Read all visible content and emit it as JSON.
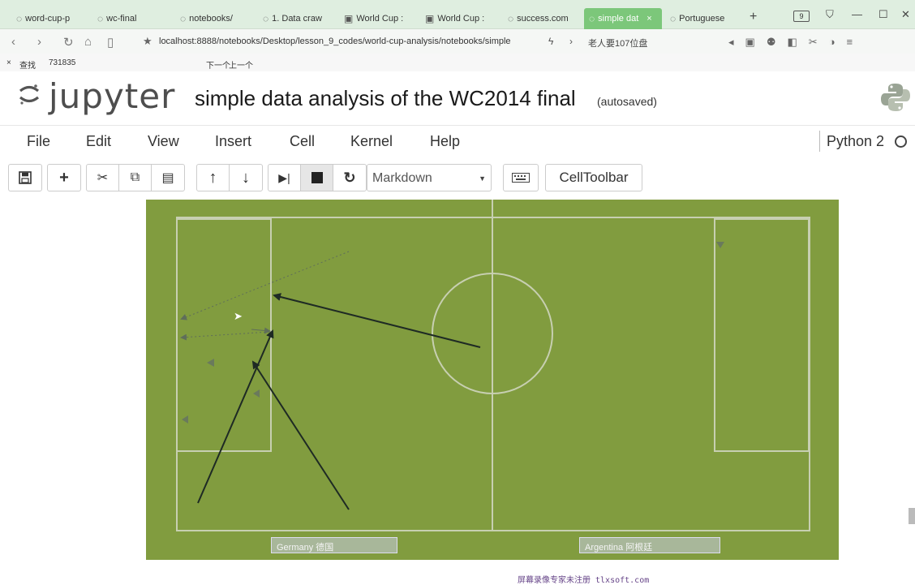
{
  "browser": {
    "tabs": [
      {
        "label": "word-cup-p"
      },
      {
        "label": "wc-final"
      },
      {
        "label": "notebooks/"
      },
      {
        "label": "1. Data craw"
      },
      {
        "label": "World Cup :"
      },
      {
        "label": "World Cup :"
      },
      {
        "label": "success.com"
      },
      {
        "label": "simple dat",
        "active": true
      },
      {
        "label": "Portuguese"
      }
    ],
    "tab_count": "9",
    "url": "localhost:8888/notebooks/Desktop/lesson_9_codes/world-cup-analysis/notebooks/simple",
    "search_hint": "老人要107位盘",
    "find": {
      "label": "查找",
      "value": "731835",
      "next": "下一个",
      "prev": "上一个"
    }
  },
  "notebook": {
    "logo": "jupyter",
    "title": "simple data analysis of the WC2014 final",
    "status": "(autosaved)",
    "menu": [
      "File",
      "Edit",
      "View",
      "Insert",
      "Cell",
      "Kernel",
      "Help"
    ],
    "kernel": "Python 2",
    "cell_type": "Markdown",
    "celltoolbar": "CellToolbar"
  },
  "pitch": {
    "colors": {
      "grass": "#819c3f",
      "line": "#c7cfb1",
      "arrow": "#1e2a24"
    },
    "captions": [
      "Germany 德国",
      "Argentina 阿根廷"
    ],
    "watermark": "屏幕录像专家未注册 tlxsoft.com"
  }
}
